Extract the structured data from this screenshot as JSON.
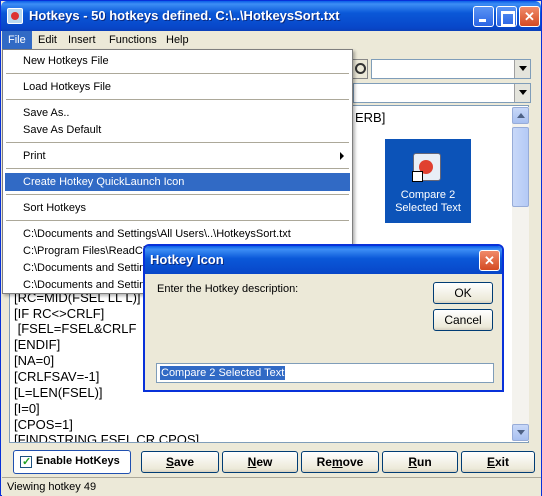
{
  "window": {
    "title": "Hotkeys - 50 hotkeys defined. C:\\..\\HotkeysSort.txt"
  },
  "menubar": [
    "File",
    "Edit",
    "Insert",
    "Functions",
    "Help"
  ],
  "file_menu": {
    "items": [
      "New Hotkeys File",
      "Load Hotkeys File",
      "Save As..",
      "Save As Default",
      "Print",
      "Create Hotkey QuickLaunch Icon",
      "Sort Hotkeys",
      "C:\\Documents and Settings\\All Users\\..\\HotkeysSort.txt",
      "C:\\Program Files\\ReadCli",
      "C:\\Documents and Settin",
      "C:\\Documents and Settin"
    ],
    "highlighted": "Create Hotkey QuickLaunch Icon"
  },
  "editor": {
    "partial_top_right": "ERB]",
    "lines": [
      "[RC=MID(FSEL LL L)]",
      "[IF RC<>CRLF]",
      " [FSEL=FSEL&CRLF",
      "[ENDIF]",
      "[NA=0]",
      "[CRLFSAV=-1]",
      "[L=LEN(FSEL)]",
      "[I=0]",
      "[CPOS=1]",
      "[FINDSTRING FSEL CR CPOS]"
    ]
  },
  "icon_preview": {
    "label": "Compare 2 Selected Text"
  },
  "bottom_bar": {
    "enable_hotkeys": "Enable HotKeys",
    "enable_checked": true,
    "buttons": {
      "save": {
        "first": "S",
        "rest": "ave"
      },
      "new": {
        "first": "N",
        "rest": "ew"
      },
      "remove": {
        "first": "Re",
        "u": "m",
        "rest": "ove"
      },
      "run": {
        "first": "R",
        "rest": "un"
      },
      "exit": {
        "first": "E",
        "rest": "xit"
      }
    }
  },
  "status": {
    "text": "Viewing hotkey 49"
  },
  "dialog": {
    "title": "Hotkey Icon",
    "prompt": "Enter the Hotkey description:",
    "ok": "OK",
    "cancel": "Cancel",
    "value": "Compare 2 Selected Text"
  },
  "colors": {
    "selection": "#316ac5",
    "titlebar": "#0a58d8",
    "desktop_tile": "#0c53b8"
  }
}
